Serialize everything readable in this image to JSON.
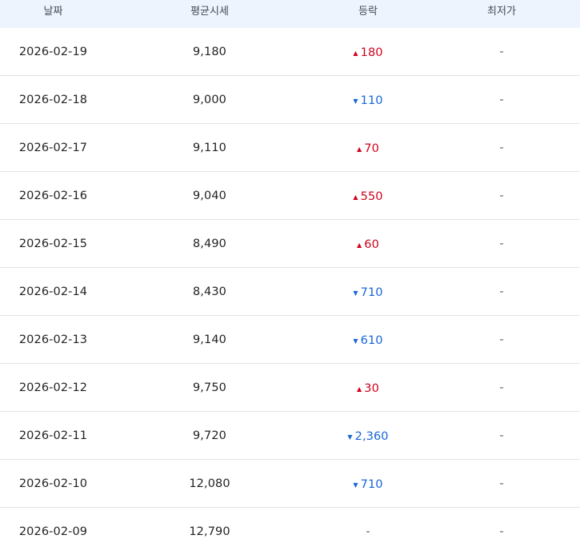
{
  "header": {
    "date": "날짜",
    "avg_price": "평균시세",
    "change": "등락",
    "lowest": "최저가"
  },
  "rows": [
    {
      "date": "2026-02-19",
      "price": "9,180",
      "dir": "up",
      "arrow": "▲",
      "change": "180",
      "lowest": "-"
    },
    {
      "date": "2026-02-18",
      "price": "9,000",
      "dir": "down",
      "arrow": "▼",
      "change": "110",
      "lowest": "-"
    },
    {
      "date": "2026-02-17",
      "price": "9,110",
      "dir": "up",
      "arrow": "▲",
      "change": "70",
      "lowest": "-"
    },
    {
      "date": "2026-02-16",
      "price": "9,040",
      "dir": "up",
      "arrow": "▲",
      "change": "550",
      "lowest": "-"
    },
    {
      "date": "2026-02-15",
      "price": "8,490",
      "dir": "up",
      "arrow": "▲",
      "change": "60",
      "lowest": "-"
    },
    {
      "date": "2026-02-14",
      "price": "8,430",
      "dir": "down",
      "arrow": "▼",
      "change": "710",
      "lowest": "-"
    },
    {
      "date": "2026-02-13",
      "price": "9,140",
      "dir": "down",
      "arrow": "▼",
      "change": "610",
      "lowest": "-"
    },
    {
      "date": "2026-02-12",
      "price": "9,750",
      "dir": "up",
      "arrow": "▲",
      "change": "30",
      "lowest": "-"
    },
    {
      "date": "2026-02-11",
      "price": "9,720",
      "dir": "down",
      "arrow": "▼",
      "change": "2,360",
      "lowest": "-"
    },
    {
      "date": "2026-02-10",
      "price": "12,080",
      "dir": "down",
      "arrow": "▼",
      "change": "710",
      "lowest": "-"
    },
    {
      "date": "2026-02-09",
      "price": "12,790",
      "dir": "flat",
      "arrow": "",
      "change": "-",
      "lowest": "-"
    }
  ],
  "colors": {
    "up": "#d0021b",
    "down": "#1565d8",
    "header_bg": "#eef4fd",
    "row_border": "#dfe3e8"
  },
  "icons": {
    "up": "triangle-up-icon",
    "down": "triangle-down-icon"
  }
}
